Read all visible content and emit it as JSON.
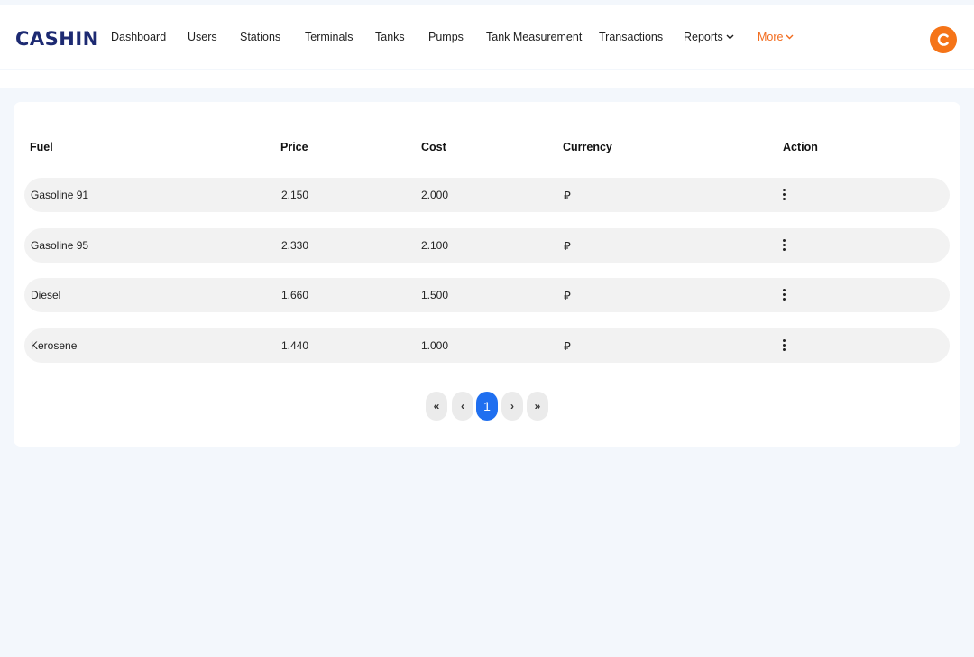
{
  "brand": {
    "logo_text": "CASHIN",
    "accent": "#f57418",
    "logo_color": "#1d2a72"
  },
  "nav": {
    "items": [
      {
        "label": "Dashboard"
      },
      {
        "label": "Users"
      },
      {
        "label": "Stations"
      },
      {
        "label": "Terminals"
      },
      {
        "label": "Tanks"
      },
      {
        "label": "Pumps"
      },
      {
        "label": "Tank Measurement"
      },
      {
        "label": "Transactions"
      },
      {
        "label": "Reports"
      },
      {
        "label": "More"
      }
    ]
  },
  "table": {
    "columns": [
      "Fuel",
      "Price",
      "Cost",
      "Currency",
      "Action"
    ],
    "rows": [
      {
        "fuel": "Gasoline 91",
        "price": "2.150",
        "cost": "2.000",
        "currency": "⃁"
      },
      {
        "fuel": "Gasoline 95",
        "price": "2.330",
        "cost": "2.100",
        "currency": "⃁"
      },
      {
        "fuel": "Diesel",
        "price": "1.660",
        "cost": "1.500",
        "currency": "⃁"
      },
      {
        "fuel": "Kerosene",
        "price": "1.440",
        "cost": "1.000",
        "currency": "⃁"
      }
    ]
  },
  "pagination": {
    "first": "«",
    "prev": "‹",
    "current": "1",
    "next": "›",
    "last": "»",
    "active_color": "#1f6ff0"
  }
}
